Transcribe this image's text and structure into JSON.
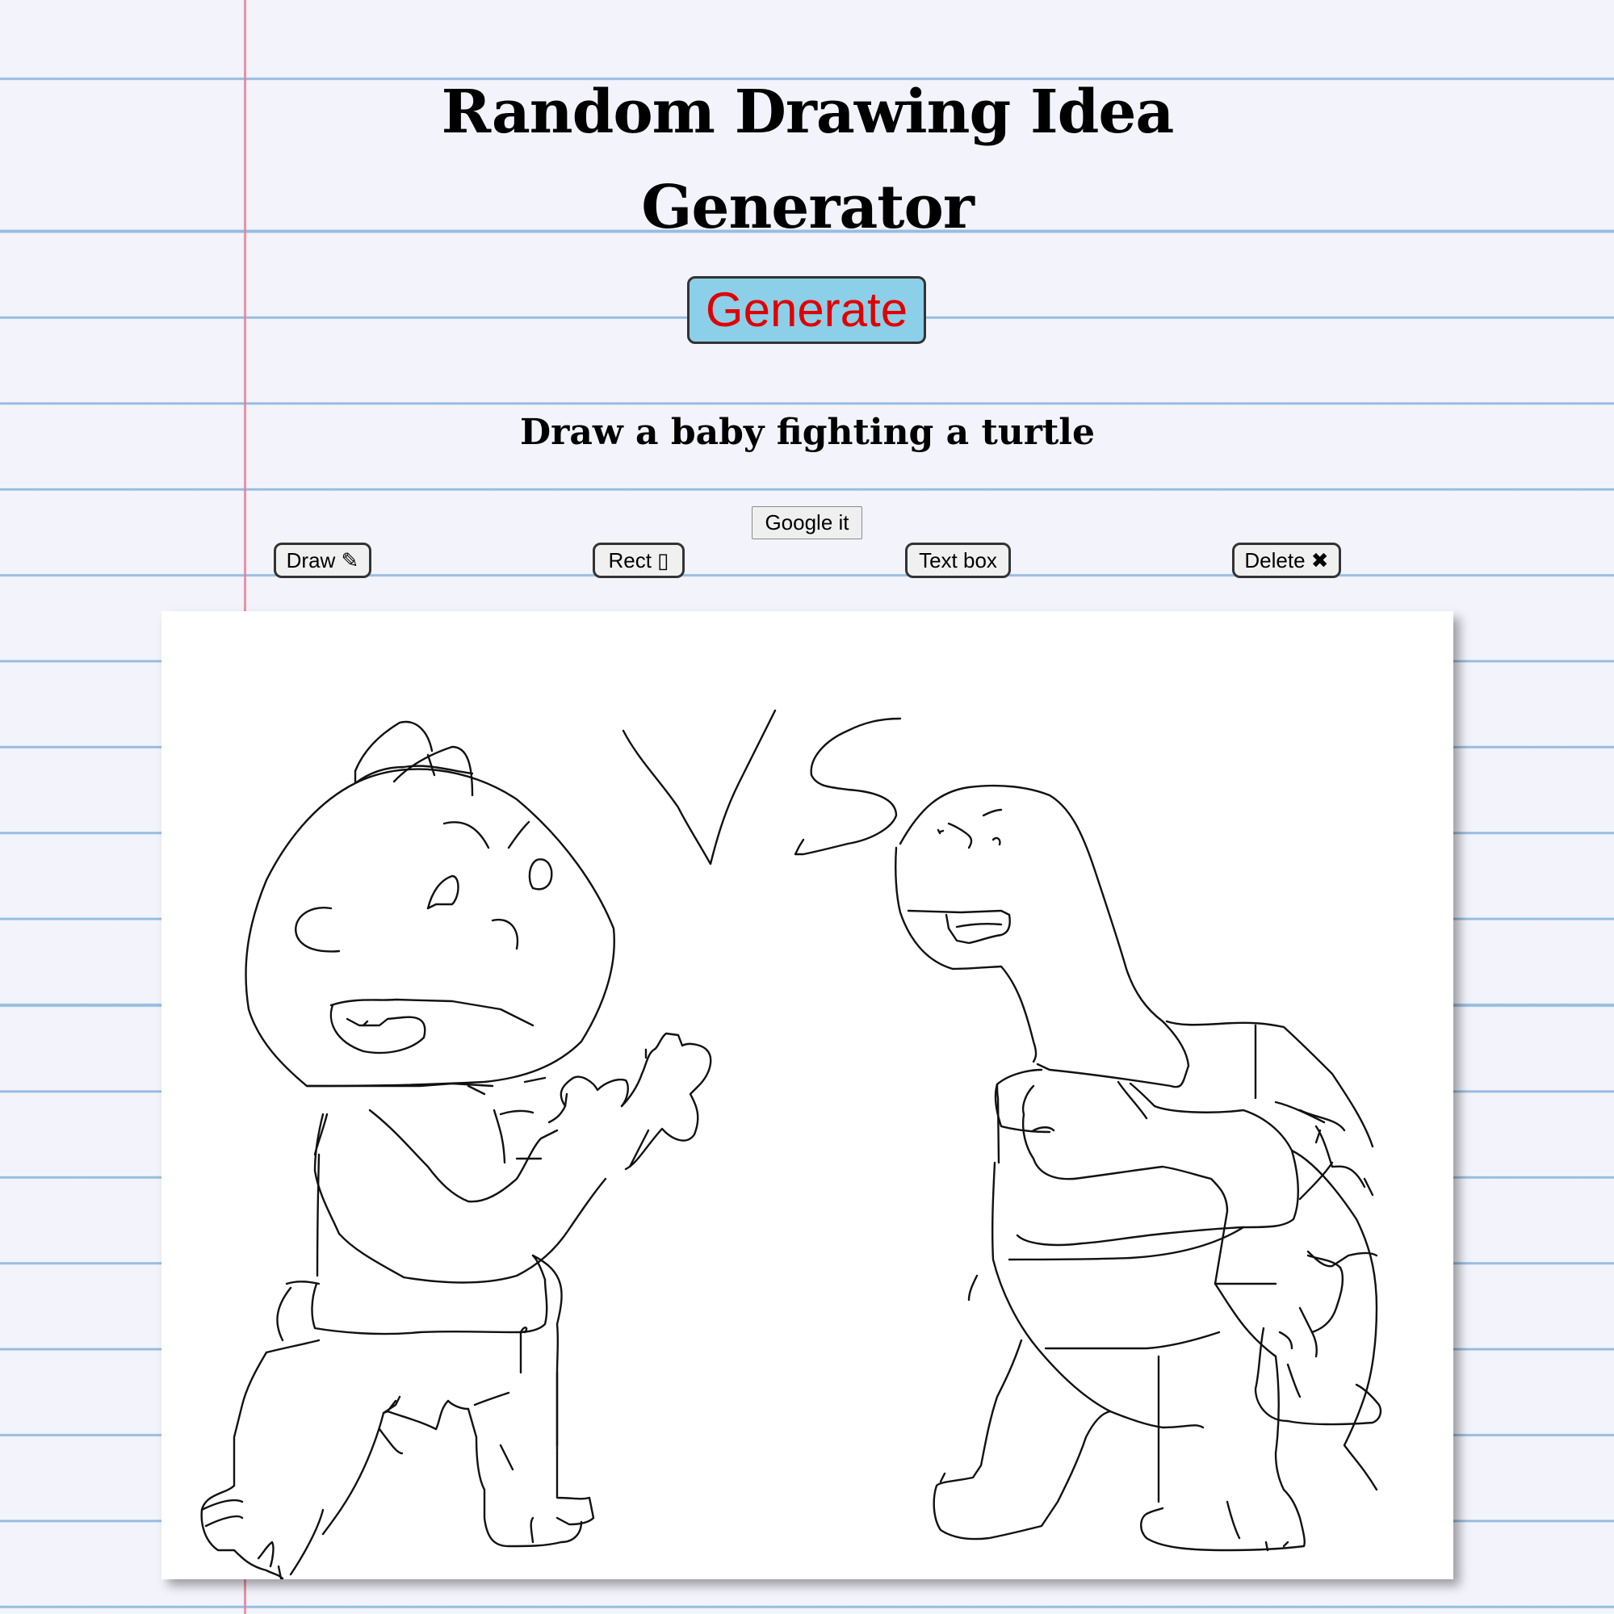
{
  "title": "Random Drawing Idea Generator",
  "generate_label": "Generate",
  "prompt": "Draw a baby fighting a turtle",
  "google_label": "Google it",
  "tools": {
    "draw": "Draw ✎",
    "rect": "Rect ▯",
    "textbox": "Text box",
    "delete": "Delete ✖"
  },
  "colors": {
    "generate_bg": "#8ccfe8",
    "generate_text": "#e00000",
    "paper_line": "#78aad7",
    "margin_line": "#eb7896"
  }
}
